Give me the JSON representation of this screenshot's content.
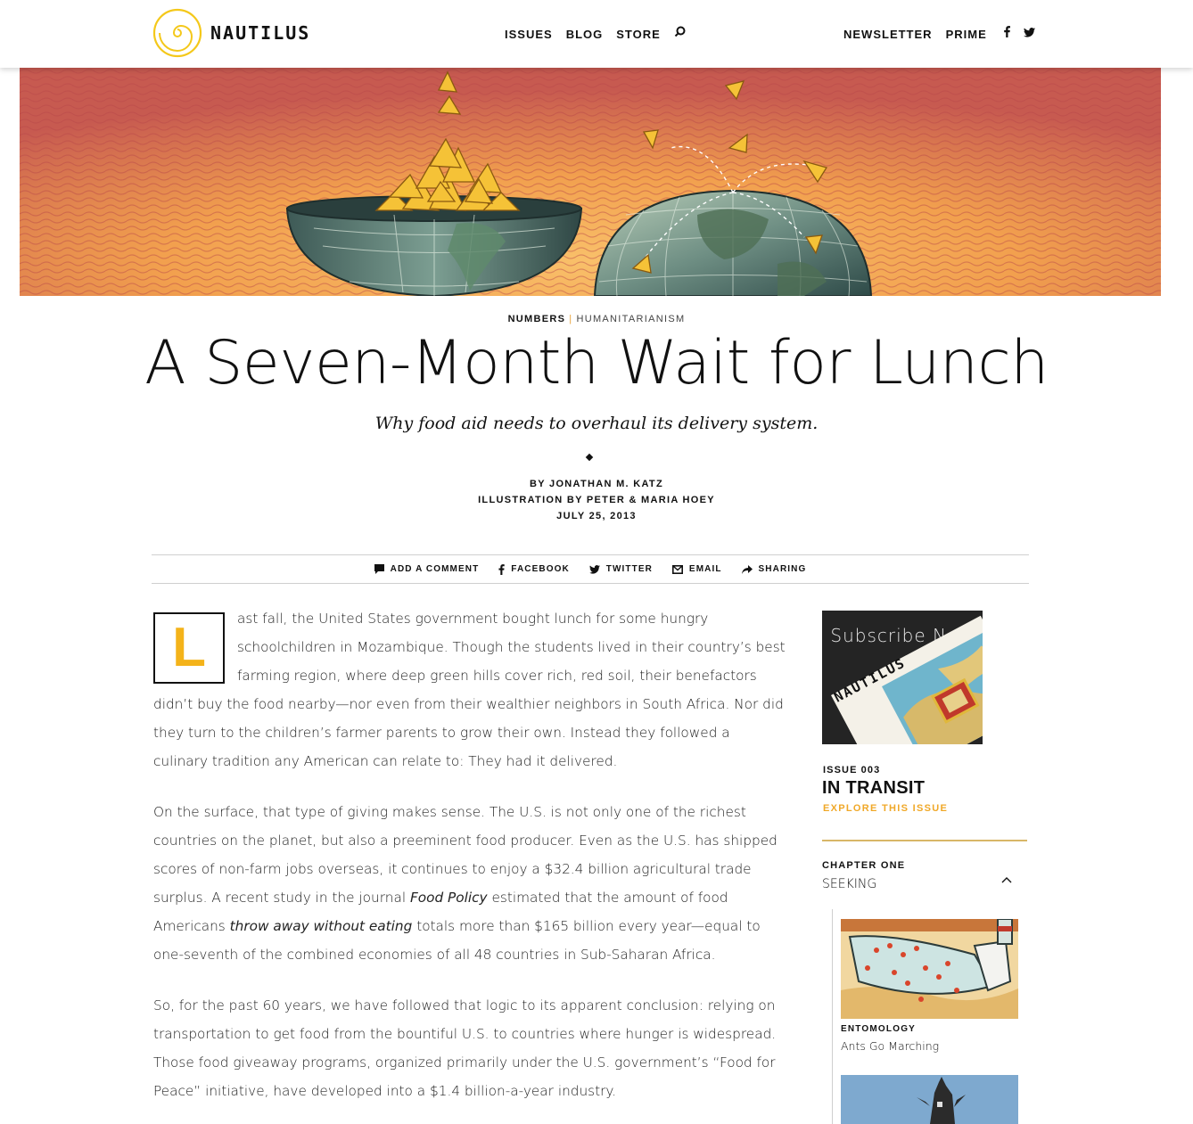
{
  "header": {
    "logo_text": "NAUTILUS",
    "nav_center": [
      "ISSUES",
      "BLOG",
      "STORE"
    ],
    "nav_right": [
      "NEWSLETTER",
      "PRIME"
    ]
  },
  "article_header": {
    "category": "NUMBERS",
    "separator": "|",
    "subcategory": "HUMANITARIANISM",
    "title": "A Seven-Month Wait for Lunch",
    "subtitle": "Why food aid needs to overhaul its delivery system.",
    "byline": "BY JONATHAN M. KATZ",
    "illustration": "ILLUSTRATION BY PETER & MARIA HOEY",
    "date": "JULY 25, 2013"
  },
  "share": {
    "comment": "ADD A COMMENT",
    "facebook": "FACEBOOK",
    "twitter": "TWITTER",
    "email": "EMAIL",
    "sharing": "SHARING"
  },
  "article": {
    "dropcap": "L",
    "p1": "ast fall, the United States government bought lunch for some hungry schoolchildren in Mozambique. Though the students lived in their country’s best farming region, where deep green hills cover rich, red soil, their benefactors didn’t buy the food nearby—nor even from their wealthier neighbors in South Africa. Nor did they turn to the children’s farmer parents to grow their own. Instead they followed a culinary tradition any American can relate to: They had it delivered.",
    "p2_a": "On the surface, that type of giving makes sense. The U.S. is not only one of the richest countries on the planet, but also a preeminent food producer. Even as the U.S. has shipped scores of non-farm jobs overseas, it continues to enjoy a $32.4 billion agricultural trade surplus. A recent study in the journal ",
    "p2_journal": "Food Policy",
    "p2_b": " estimated that the amount of food Americans ",
    "p2_emph": "throw away without eating",
    "p2_c": " totals more than $165 billion every year—equal to one-seventh of the combined economies of all 48 countries in Sub-Saharan Africa.",
    "p3": "So, for the past 60 years, we have followed that logic to its apparent conclusion: relying on transportation to get food from the bountiful U.S. to countries where hunger is widespread. Those food giveaway programs, organized primarily under the U.S. government’s “Food for Peace” initiative, have developed into a $1.4 billion-a-year industry."
  },
  "sidebar": {
    "subscribe_label": "Subscribe Now",
    "magazine_cover_text": "NAUTILUS",
    "issue_number": "ISSUE 003",
    "issue_title": "IN TRANSIT",
    "explore": "EXPLORE THIS ISSUE",
    "chapter_label": "CHAPTER ONE",
    "chapter_name": "SEEKING",
    "items": [
      {
        "tag": "ENTOMOLOGY",
        "title": "Ants Go Marching"
      }
    ]
  },
  "colors": {
    "accent_gold": "#f4b31a",
    "explore_orange": "#f0a828",
    "hero_orange": "#f1a650"
  }
}
